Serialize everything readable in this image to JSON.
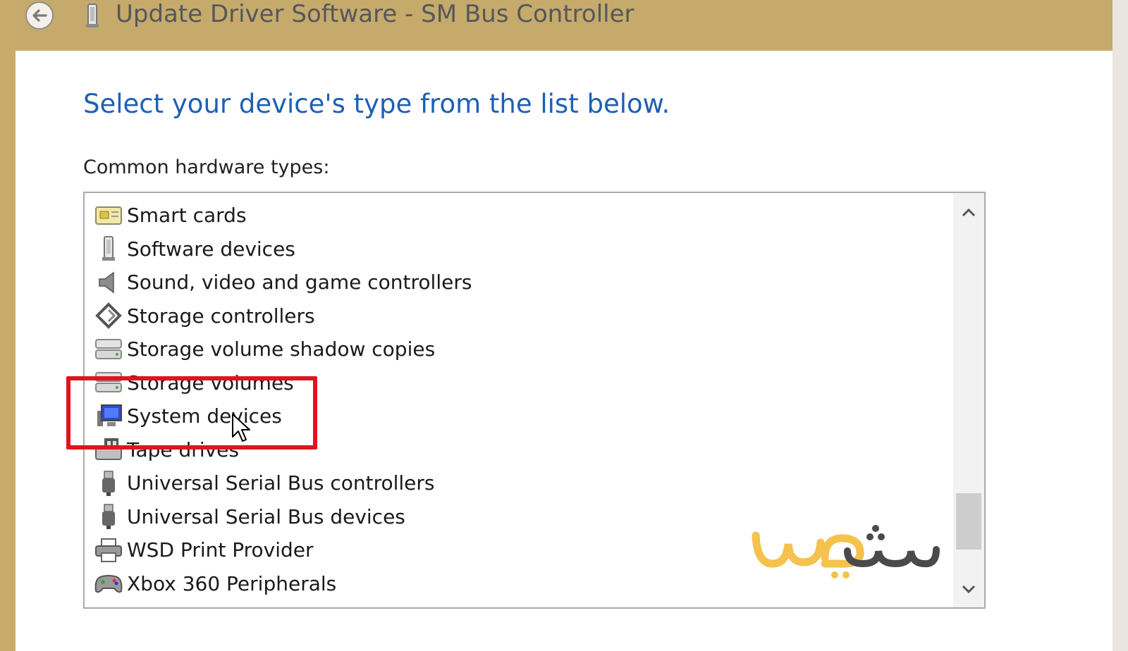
{
  "window": {
    "title": "Update Driver Software - SM Bus Controller"
  },
  "main": {
    "heading": "Select your device's type from the list below.",
    "list_label": "Common hardware types:"
  },
  "hardware_types": [
    {
      "label": "Smart cards",
      "icon": "smart-card-icon"
    },
    {
      "label": "Software devices",
      "icon": "software-device-icon"
    },
    {
      "label": "Sound, video and game controllers",
      "icon": "speaker-icon"
    },
    {
      "label": "Storage controllers",
      "icon": "storage-controller-icon"
    },
    {
      "label": "Storage volume shadow copies",
      "icon": "drive-icon"
    },
    {
      "label": "Storage volumes",
      "icon": "drive-icon"
    },
    {
      "label": "System devices",
      "icon": "system-device-icon"
    },
    {
      "label": "Tape drives",
      "icon": "tape-drive-icon"
    },
    {
      "label": "Universal Serial Bus controllers",
      "icon": "usb-icon"
    },
    {
      "label": "Universal Serial Bus devices",
      "icon": "usb-icon"
    },
    {
      "label": "WSD Print Provider",
      "icon": "printer-icon"
    },
    {
      "label": "Xbox 360 Peripherals",
      "icon": "gamepad-icon"
    }
  ],
  "highlighted_item": "System devices",
  "scrollbar": {
    "position": 0.92
  },
  "colors": {
    "title_bar": "#c5aa6b",
    "heading": "#1e5fb4",
    "highlight_box": "#e0141e",
    "watermark_yellow": "#f4c24d",
    "watermark_gray": "#4a4a4a"
  },
  "watermark": {
    "text": "ويب سي"
  }
}
